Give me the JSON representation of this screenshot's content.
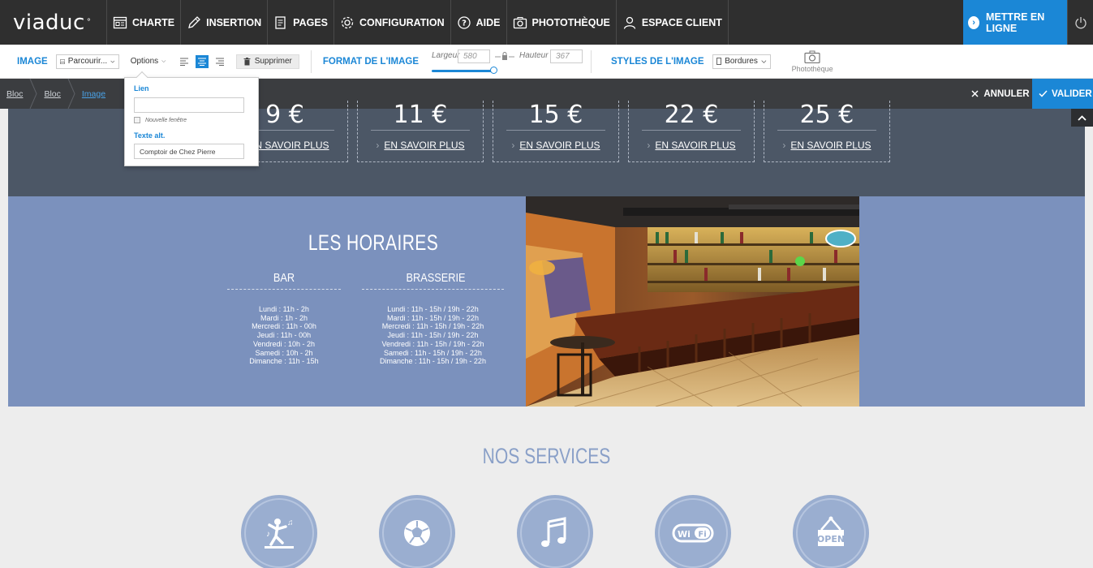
{
  "brand": {
    "name": "viaduc"
  },
  "nav": {
    "items": [
      {
        "label": "CHARTE",
        "icon": "charte-icon"
      },
      {
        "label": "INSERTION",
        "icon": "pencil-icon"
      },
      {
        "label": "PAGES",
        "icon": "pages-icon"
      },
      {
        "label": "CONFIGURATION",
        "icon": "gear-icon"
      },
      {
        "label": "AIDE",
        "icon": "help-icon"
      },
      {
        "label": "PHOTOTHÈQUE",
        "icon": "camera-icon"
      },
      {
        "label": "ESPACE CLIENT",
        "icon": "user-icon"
      }
    ],
    "publish_label": "METTRE EN LIGNE"
  },
  "toolbar": {
    "image_label": "IMAGE",
    "browse_label": "Parcourir...",
    "options_label": "Options",
    "delete_label": "Supprimer",
    "format_label": "FORMAT DE L'IMAGE",
    "width_label": "Largeur",
    "width_value": "580",
    "height_label": "Hauteur",
    "height_value": "367",
    "styles_label": "STYLES DE L'IMAGE",
    "borders_label": "Bordures",
    "phototheque_label": "Photothèque",
    "accent": "#1b87d6"
  },
  "breadcrumb": {
    "items": [
      "Bloc",
      "Bloc",
      "Image"
    ],
    "cancel_label": "ANNULER",
    "validate_label": "VALIDER"
  },
  "popover": {
    "link_label": "Lien",
    "link_value": "",
    "new_window_label": "Nouvelle fenêtre",
    "alt_label": "Texte alt.",
    "alt_value": "Comptoir de Chez Pierre"
  },
  "prices": {
    "cards": [
      {
        "price": "9 €",
        "link": "EN SAVOIR PLUS"
      },
      {
        "price": "11 €",
        "link": "EN SAVOIR PLUS"
      },
      {
        "price": "15 €",
        "link": "EN SAVOIR PLUS"
      },
      {
        "price": "22 €",
        "link": "EN SAVOIR PLUS"
      },
      {
        "price": "25 €",
        "link": "EN SAVOIR PLUS"
      }
    ]
  },
  "hours": {
    "title": "LES HORAIRES",
    "bar": {
      "title": "BAR",
      "lines": [
        "Lundi : 11h - 2h",
        "Mardi : 1h - 2h",
        "Mercredi : 11h - 00h",
        "Jeudi : 11h - 00h",
        "Vendredi : 10h - 2h",
        "Samedi : 10h - 2h",
        "Dimanche : 11h - 15h"
      ]
    },
    "brasserie": {
      "title": "BRASSERIE",
      "lines": [
        "Lundi : 11h - 15h / 19h - 22h",
        "Mardi : 11h - 15h / 19h - 22h",
        "Mercredi : 11h - 15h / 19h - 22h",
        "Jeudi : 11h - 15h / 19h - 22h",
        "Vendredi : 11h - 15h / 19h - 22h",
        "Samedi : 11h - 15h / 19h - 22h",
        "Dimanche : 11h - 15h / 19h - 22h"
      ]
    }
  },
  "services": {
    "title": "NOS SERVICES",
    "items": [
      {
        "icon": "dance-icon"
      },
      {
        "icon": "soccer-ball-icon"
      },
      {
        "icon": "music-note-icon"
      },
      {
        "icon": "wifi-icon",
        "text": "wi fi"
      },
      {
        "icon": "open-sign-icon",
        "text": "OPEN"
      }
    ]
  }
}
